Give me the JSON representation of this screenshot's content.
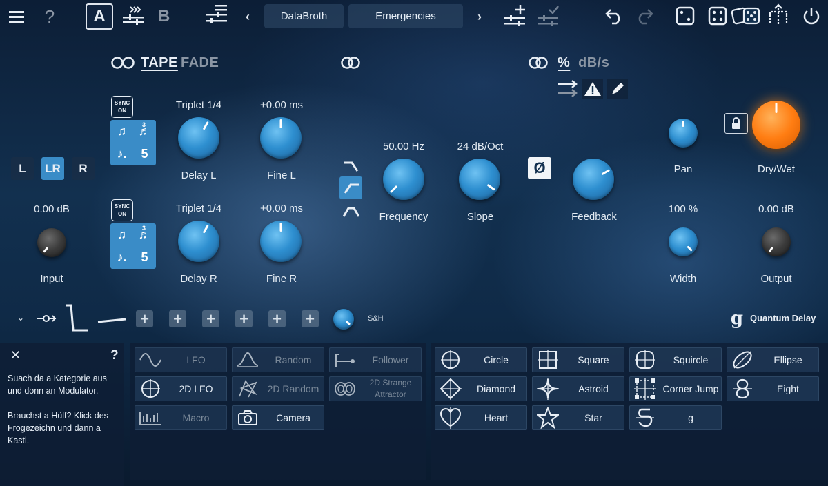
{
  "topbar": {
    "preset_bank": "DataBroth",
    "preset_name": "Emergencies",
    "ab_a": "A",
    "ab_b": "B"
  },
  "header": {
    "tape": "TAPE",
    "fade": "FADE",
    "percent": "%",
    "dbs": "dB/s"
  },
  "left": {
    "lr": [
      "L",
      "LR",
      "R"
    ],
    "input_value": "0.00 dB",
    "input_label": "Input"
  },
  "delay_l": {
    "sync_top": "SYNC",
    "sync_bottom": "ON",
    "note_count": "5",
    "note_triplet_mark": "3",
    "time_value": "Triplet 1/4",
    "time_label": "Delay L",
    "fine_value": "+0.00 ms",
    "fine_label": "Fine L"
  },
  "delay_r": {
    "sync_top": "SYNC",
    "sync_bottom": "ON",
    "note_count": "5",
    "note_triplet_mark": "3",
    "time_value": "Triplet 1/4",
    "time_label": "Delay R",
    "fine_value": "+0.00 ms",
    "fine_label": "Fine R"
  },
  "filter": {
    "freq_value": "50.00 Hz",
    "freq_label": "Frequency",
    "slope_value": "24 dB/Oct",
    "slope_label": "Slope",
    "phase_symbol": "Ø",
    "feedback_label": "Feedback"
  },
  "right": {
    "pan_label": "Pan",
    "drywet_label": "Dry/Wet",
    "width_value": "100 %",
    "width_label": "Width",
    "output_value": "0.00 dB",
    "output_label": "Output"
  },
  "mod_strip": {
    "sh_label": "S&H",
    "brand": "Quantum Delay"
  },
  "help": {
    "close": "✕",
    "question": "?",
    "text1": "Suach da a Kategorie aus und donn an Modulator.",
    "text2": "Brauchst a Hülf? Klick des Frogezeichn und dann a Kastl."
  },
  "modulators": [
    {
      "label": "LFO",
      "icon": "sine-wave-icon",
      "dim": true
    },
    {
      "label": "Random",
      "icon": "bell-curve-icon",
      "dim": true
    },
    {
      "label": "Follower",
      "icon": "follower-icon",
      "dim": true
    },
    {
      "label": "2D LFO",
      "icon": "circle-crosshair-icon",
      "dim": false
    },
    {
      "label": "2D Random",
      "icon": "random-2d-icon",
      "dim": true
    },
    {
      "label": "2D Strange Attractor",
      "icon": "attractor-icon",
      "dim": true
    },
    {
      "label": "Macro",
      "icon": "macro-icon",
      "dim": true
    },
    {
      "label": "Camera",
      "icon": "camera-icon",
      "dim": false
    }
  ],
  "shapes": [
    {
      "label": "Circle",
      "icon": "circle-shape-icon"
    },
    {
      "label": "Square",
      "icon": "square-shape-icon"
    },
    {
      "label": "Squircle",
      "icon": "squircle-shape-icon"
    },
    {
      "label": "Ellipse",
      "icon": "ellipse-shape-icon"
    },
    {
      "label": "Diamond",
      "icon": "diamond-shape-icon"
    },
    {
      "label": "Astroid",
      "icon": "astroid-shape-icon"
    },
    {
      "label": "Corner Jump",
      "icon": "corner-jump-icon"
    },
    {
      "label": "Eight",
      "icon": "eight-shape-icon"
    },
    {
      "label": "Heart",
      "icon": "heart-shape-icon"
    },
    {
      "label": "Star",
      "icon": "star-shape-icon"
    },
    {
      "label": "g",
      "icon": "g-shape-icon"
    }
  ],
  "colors": {
    "accent": "#3a8cc7",
    "drywet": "#ff7d12"
  }
}
